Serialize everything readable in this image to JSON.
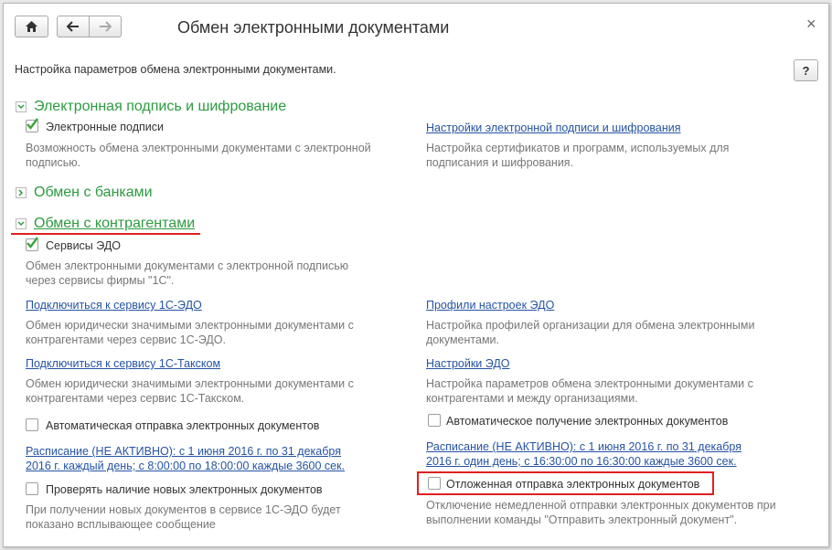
{
  "window": {
    "title": "Обмен электронными документами",
    "close_glyph": "×",
    "help_label": "?",
    "subtitle": "Настройка параметров обмена электронными документами."
  },
  "sections": {
    "signature": {
      "title": "Электронная подпись и шифрование",
      "expanded": true,
      "checkbox_label": "Электронные подписи",
      "checkbox_checked": true,
      "checkbox_desc_1": "Возможность обмена электронными документами с электронной",
      "checkbox_desc_2": "подписью.",
      "link": "Настройки электронной подписи и шифрования",
      "link_desc_1": "Настройка сертификатов и программ, используемых для",
      "link_desc_2": "подписания и шифрования."
    },
    "banks": {
      "title": "Обмен с банками",
      "expanded": false
    },
    "counterparties": {
      "title": "Обмен с контрагентами",
      "expanded": true,
      "edo_label": "Сервисы ЭДО",
      "edo_checked": true,
      "edo_desc_1": "Обмен электронными документами с электронной подписью",
      "edo_desc_2": "через сервисы фирмы \"1С\".",
      "connect_edo_link": "Подключиться к сервису 1С-ЭДО",
      "connect_edo_desc_1": "Обмен юридически значимыми электронными документами с",
      "connect_edo_desc_2": "контрагентами через сервис 1С-ЭДО.",
      "connect_taxcom_link": "Подключиться к сервису 1С-Такском",
      "connect_taxcom_desc_1": "Обмен юридически значимыми электронными документами с",
      "connect_taxcom_desc_2": "контрагентами через сервис 1С-Такском.",
      "auto_send_label": "Автоматическая отправка электронных документов",
      "auto_send_checked": false,
      "auto_send_schedule_1": "Расписание (НЕ АКТИВНО): с 1 июня 2016 г. по 31 декабря",
      "auto_send_schedule_2": "2016 г. каждый  день; с 8:00:00 по 18:00:00 каждые 3600 сек.",
      "check_new_label": "Проверять наличие новых электронных документов",
      "check_new_checked": false,
      "check_new_desc_1": "При получении новых документов в сервисе 1С-ЭДО будет",
      "check_new_desc_2": "показано всплывающее сообщение",
      "profiles_link": "Профили настроек ЭДО",
      "profiles_desc_1": "Настройка профилей организации для обмена электронными",
      "profiles_desc_2": "документами.",
      "edo_settings_link": "Настройки ЭДО",
      "edo_settings_desc_1": "Настройка параметров обмена электронными документами с",
      "edo_settings_desc_2": "контрагентами и между организациями.",
      "auto_receive_label": "Автоматическое получение электронных документов",
      "auto_receive_checked": false,
      "auto_receive_schedule_1": "Расписание (НЕ АКТИВНО): с 1 июня 2016 г. по 31 декабря",
      "auto_receive_schedule_2": "2016 г. один день; с 16:30:00 по 16:30:00 каждые 3600 сек.",
      "delayed_send_label": "Отложенная отправка электронных документов",
      "delayed_send_checked": false,
      "delayed_send_desc_1": "Отключение немедленной отправки электронных документов при",
      "delayed_send_desc_2": "выполнении команды \"Отправить электронный документ\"."
    }
  },
  "colors": {
    "section_title": "#2c9b3f",
    "link": "#2553a3",
    "description": "#777777",
    "highlight": "#e02020",
    "checkmark": "#3aa33a"
  }
}
